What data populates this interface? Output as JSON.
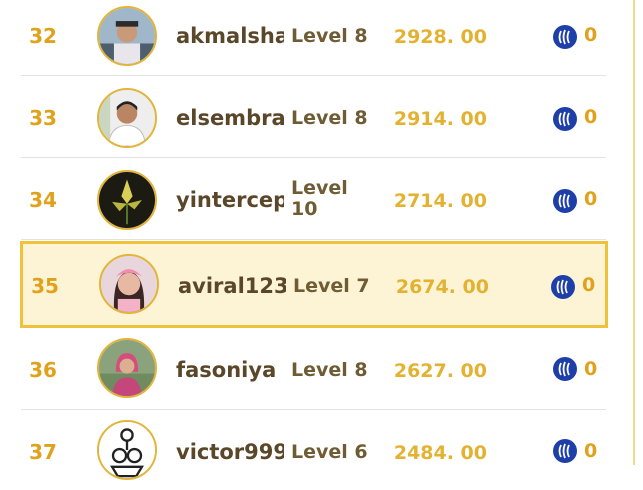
{
  "leaderboard": {
    "rows": [
      {
        "rank": "32",
        "username": "akmalsha",
        "level": "Level 8",
        "score": "2928. 00",
        "reward": "0"
      },
      {
        "rank": "33",
        "username": "elsembra",
        "level": "Level 8",
        "score": "2914. 00",
        "reward": "0"
      },
      {
        "rank": "34",
        "username": "yintercep",
        "level": "Level 10",
        "score": "2714. 00",
        "reward": "0"
      },
      {
        "rank": "35",
        "username": "aviral123",
        "level": "Level 7",
        "score": "2674. 00",
        "reward": "0",
        "highlighted": true
      },
      {
        "rank": "36",
        "username": "fasoniya",
        "level": "Level 8",
        "score": "2627. 00",
        "reward": "0"
      },
      {
        "rank": "37",
        "username": "victor999",
        "level": "Level 6",
        "score": "2484. 00",
        "reward": "0"
      }
    ]
  },
  "colors": {
    "accent": "#e0a21c",
    "highlight_border": "#f0c23c",
    "highlight_bg": "#fdf4d5",
    "steem_icon": "#1f3fa8"
  },
  "icons": {
    "reward": "steem-icon"
  }
}
